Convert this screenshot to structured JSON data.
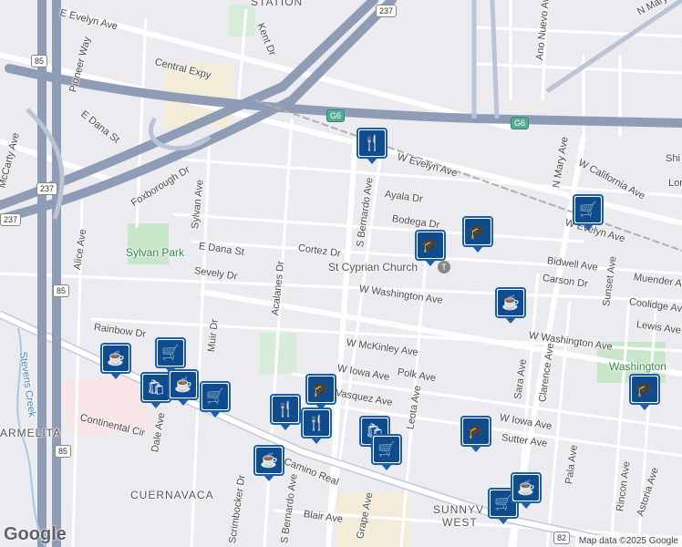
{
  "map": {
    "streets": [
      "E Evelyn Ave",
      "Central Expy",
      "Pioneer Way",
      "E Dana St",
      "Foxborough Dr",
      "Sylvan Ave",
      "Kent Dr",
      "Ayala Dr",
      "Bodega Dr",
      "Cortez Dr",
      "S Bernardo Ave",
      "W Evelyn Ave",
      "W California Ave",
      "N Mary Ave",
      "Ano Nuevo Ave",
      "N Mary",
      "E Dana St",
      "Sevely Dr",
      "Acalanes Dr",
      "Muir Dr",
      "Alice Ave",
      "McCarty Ave",
      "Rainbow Dr",
      "El Camino Real",
      "W Washington Ave",
      "W McKinley Ave",
      "W Iowa Ave",
      "Polk Ave",
      "Vasquez Ave",
      "Leota Ave",
      "Sutter Ave",
      "Bidwell Ave",
      "Carson Dr",
      "Muender Ave",
      "Coolidge Ave",
      "Lewis Ave",
      "Sunset Ave",
      "Sara Ave",
      "Clarence Ave",
      "W Washington Ave",
      "W Iowa Ave",
      "Pala Ave",
      "Rincon Ave",
      "Astoria Ave",
      "Continental Cir",
      "Dale Ave",
      "Blair Ave",
      "Grape Ave",
      "S Bernardo Ave",
      "Scrimbocker Dr",
      "Shi",
      "Lor",
      "W Evelyn Ave"
    ],
    "places": {
      "station": "STATION",
      "park": "Sylvan Park",
      "church": "St Cyprian Church",
      "area1": "CUERNAVACA",
      "area2": "ARMELITA",
      "area3": "SUNNYV",
      "area4": "WEST",
      "school": "Washington",
      "creek": "Stevens Creek"
    },
    "highways": [
      "85",
      "237",
      "237",
      "237",
      "85",
      "85",
      "G6",
      "G6",
      "82"
    ],
    "church_marker": "T",
    "pins": [
      "restaurant-icon",
      "school-icon",
      "school-icon",
      "shopping-cart-icon",
      "coffee-icon",
      "coffee-icon",
      "shopping-cart-icon",
      "shopping-bag-icon",
      "coffee-icon",
      "shopping-cart-icon",
      "restaurant-icon",
      "school-icon",
      "restaurant-icon",
      "shopping-bag-icon",
      "shopping-cart-icon",
      "school-icon",
      "coffee-icon",
      "shopping-cart-icon",
      "coffee-icon",
      "school-icon"
    ],
    "logo": "Google",
    "attribution": "Map data ©2025 Google"
  }
}
